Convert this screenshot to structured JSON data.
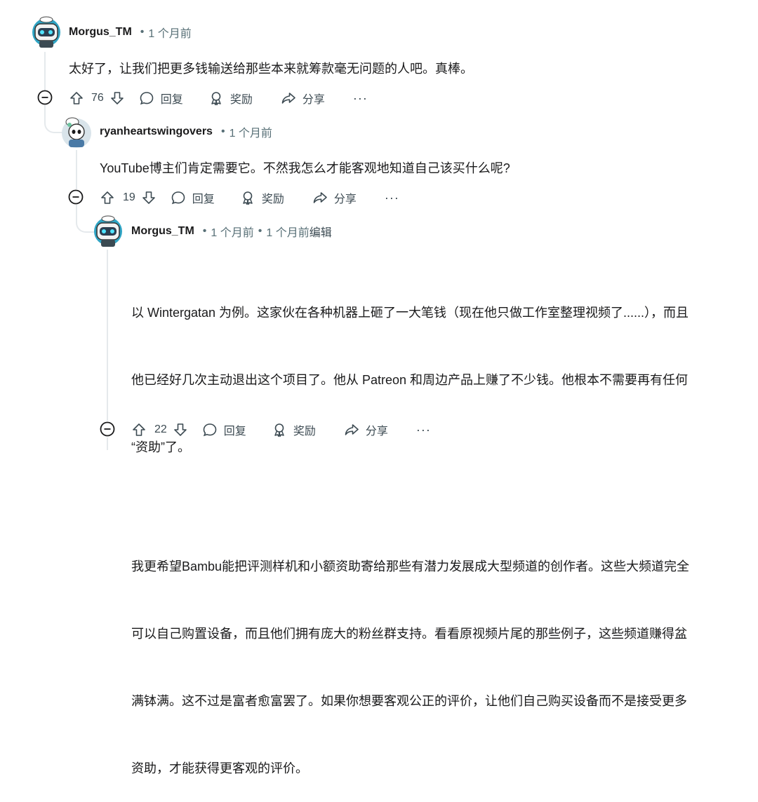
{
  "comments": [
    {
      "author": "Morgus_TM",
      "time": "1 个月前",
      "body": "太好了，让我们把更多钱输送给那些本来就筹款毫无问题的人吧。真棒。",
      "votes": "76"
    },
    {
      "author": "ryanheartswingovers",
      "time": "1 个月前",
      "body": "YouTube博主们肯定需要它。不然我怎么才能客观地知道自己该买什么呢?",
      "votes": "19"
    },
    {
      "author": "Morgus_TM",
      "time": "1 个月前",
      "edited_time": "1 个月前",
      "edited_label": "编辑",
      "body_p1_l1": "以 Wintergatan 为例。这家伙在各种机器上砸了一大笔钱（现在他只做工作室整理视频了......），而且",
      "body_p1_l2": "他已经好几次主动退出这个项目了。他从 Patreon 和周边产品上赚了不少钱。他根本不需要再有任何",
      "body_p1_l3": "“资助”了。",
      "body_p2_l1": "我更希望Bambu能把评测样机和小额资助寄给那些有潜力发展成大型频道的创作者。这些大频道完全",
      "body_p2_l2": "可以自己购置设备，而且他们拥有庞大的粉丝群支持。看看原视频片尾的那些例子，这些频道赚得盆",
      "body_p2_l3": "满钵满。这不过是富者愈富罢了。如果你想要客观公正的评价，让他们自己购买设备而不是接受更多",
      "body_p2_l4": "资助，才能获得更客观的评价。",
      "votes": "22"
    }
  ],
  "actions": {
    "reply": "回复",
    "award": "奖励",
    "share": "分享",
    "more": "···"
  },
  "separator": "•",
  "colors": {
    "text": "#1a1a1b",
    "meta": "#576f76",
    "line": "#e5e9ec"
  }
}
